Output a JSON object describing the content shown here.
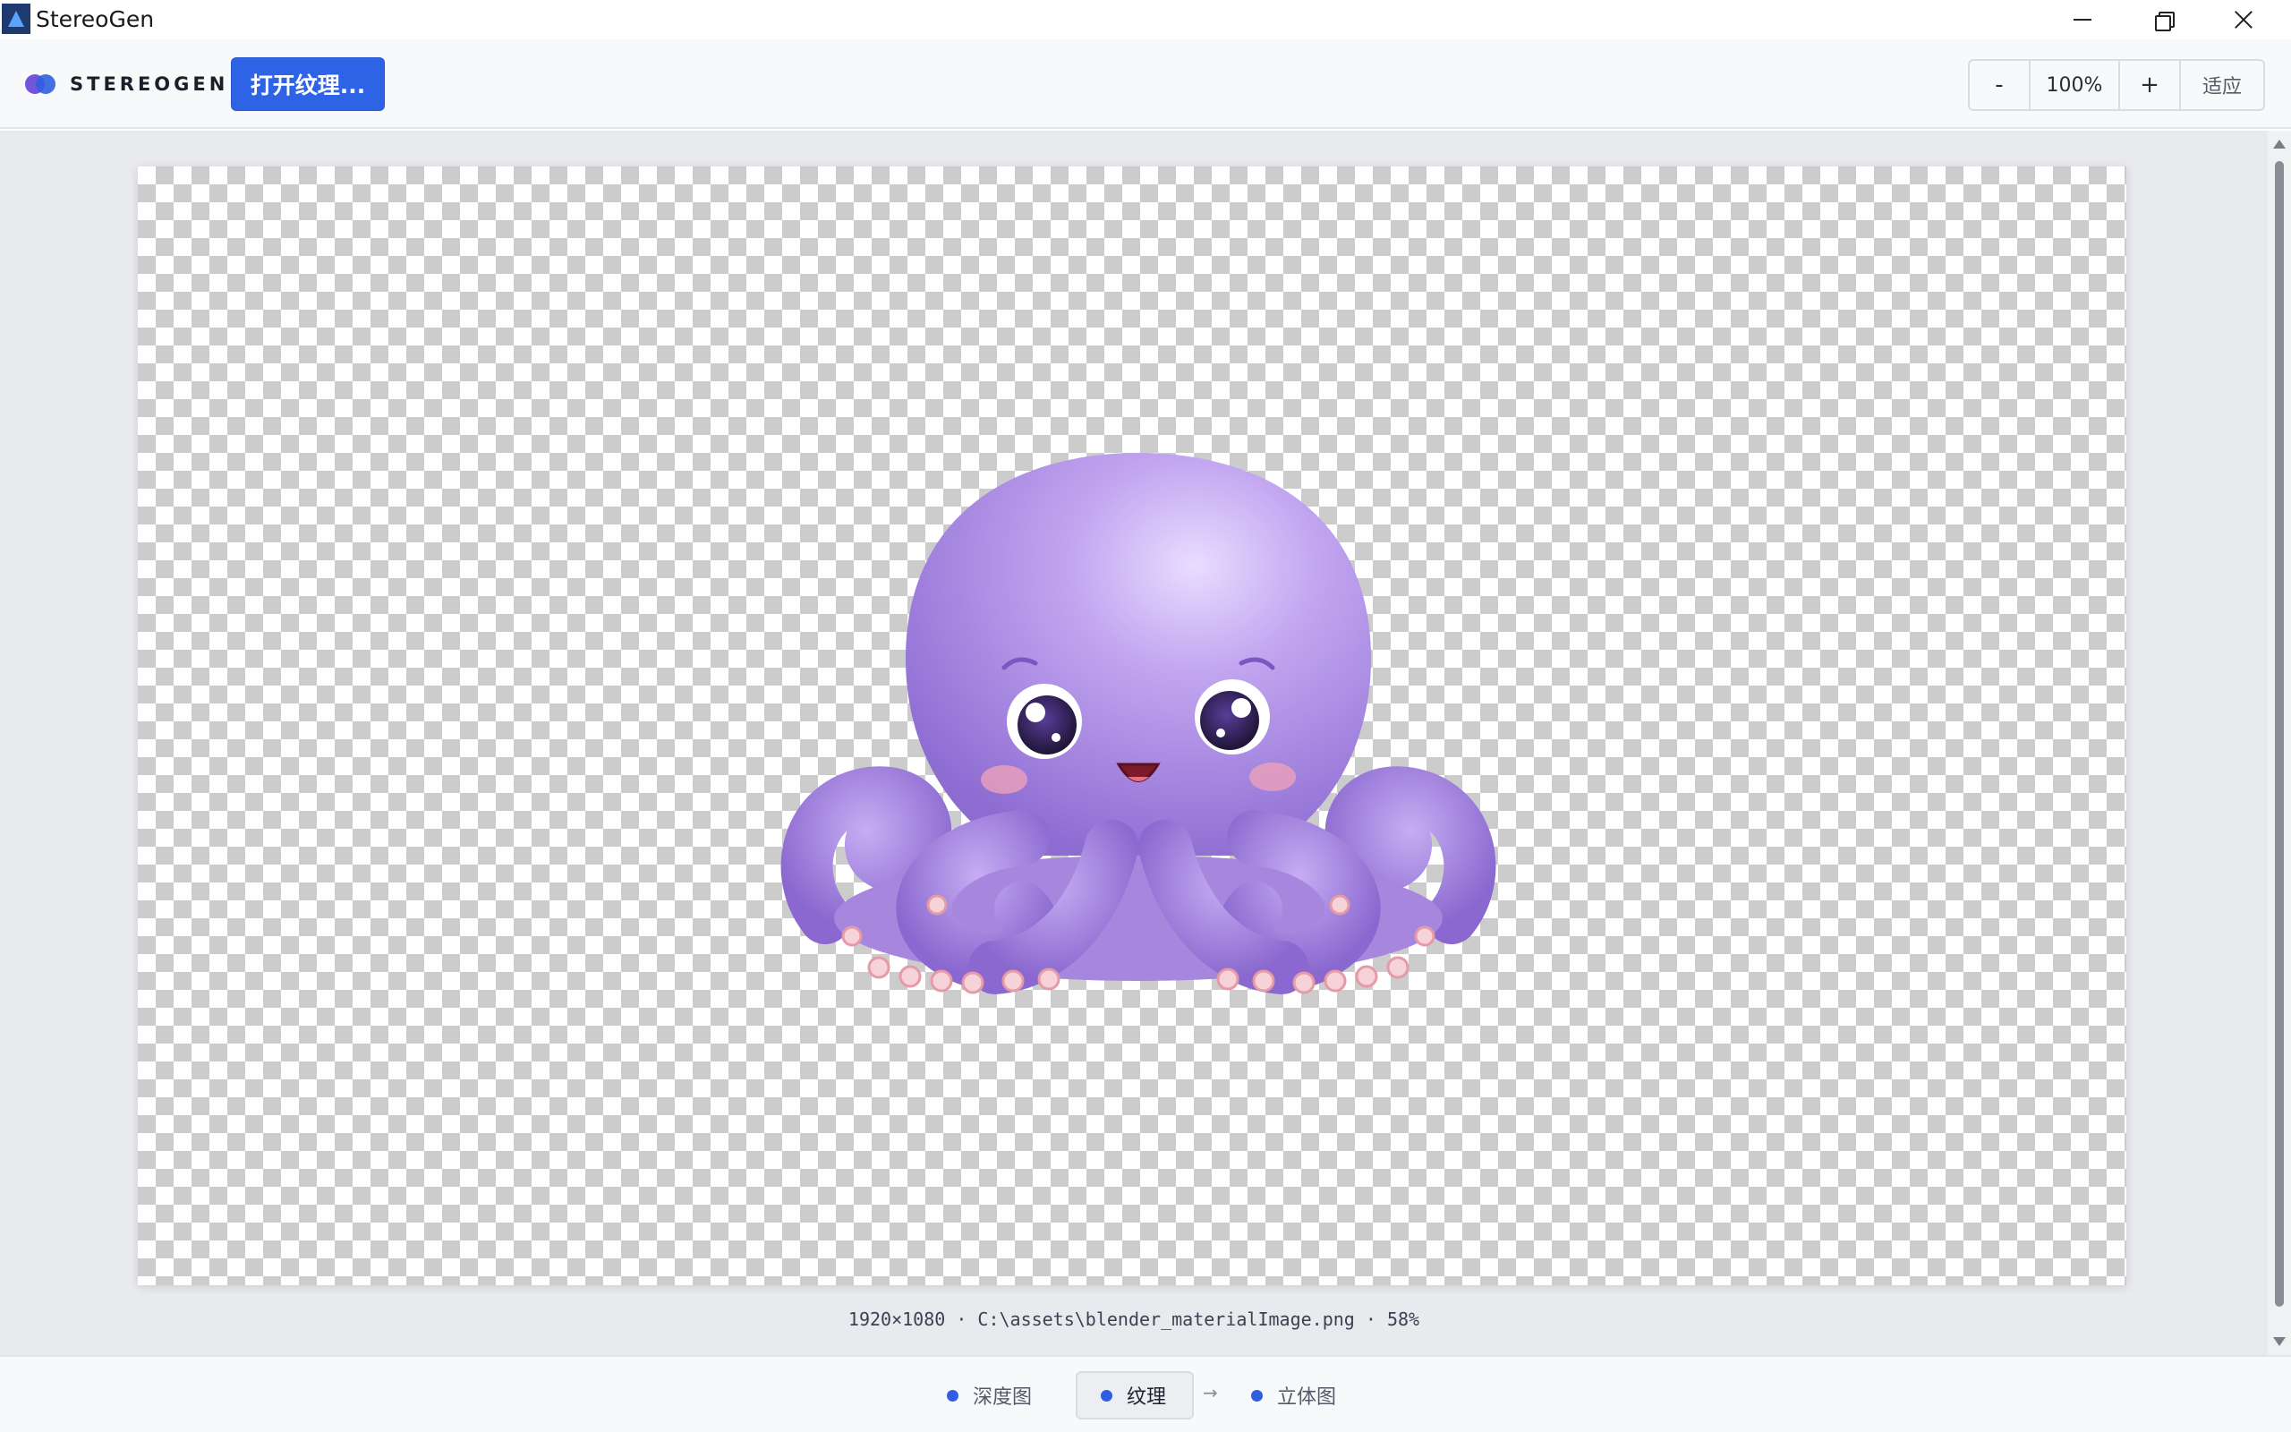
{
  "window": {
    "title": "StereoGen"
  },
  "toolbar": {
    "brand_name": "STEREOGEN",
    "open_texture_label": "打开纹理...",
    "zoom": {
      "minus_label": "-",
      "value": "100%",
      "plus_label": "+",
      "fit_label": "适应"
    }
  },
  "canvas": {
    "info": "1920×1080 · C:\\assets\\blender_materialImage.png · 58%"
  },
  "steps": [
    {
      "label": "深度图"
    },
    {
      "label": "纹理"
    },
    {
      "label": "立体图"
    }
  ],
  "step_arrow": "→",
  "colors": {
    "accent": "#2f63e6",
    "toolbar_bg": "#f8f9fb",
    "workspace_bg": "#e8eaee"
  },
  "icons": {
    "app": "stereogen-app-icon",
    "brand": "stereogen-logo-icon",
    "minimize": "minimize-icon",
    "restore": "restore-icon",
    "close": "close-icon"
  }
}
